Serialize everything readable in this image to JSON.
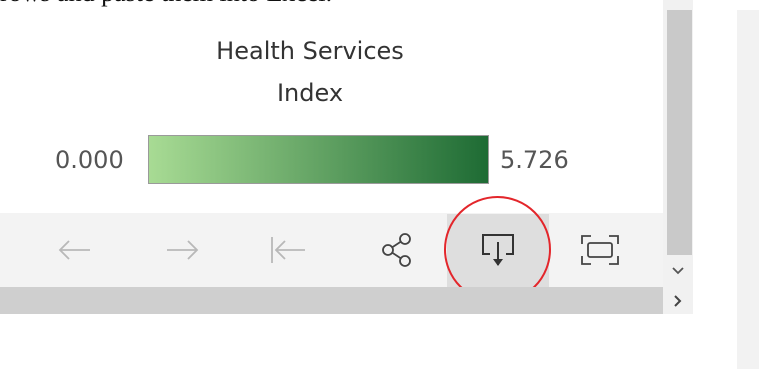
{
  "document": {
    "partial_text": "rows and paste them into Excel."
  },
  "legend": {
    "title_line1": "Health Services",
    "title_line2": "Index",
    "min": "0.000",
    "max": "5.726",
    "gradient_start": "#a8db94",
    "gradient_end": "#1e6b34"
  },
  "toolbar": {
    "buttons": [
      {
        "icon": "undo-arrow-icon",
        "enabled": false
      },
      {
        "icon": "redo-arrow-icon",
        "enabled": false
      },
      {
        "icon": "revert-icon",
        "enabled": false
      },
      {
        "icon": "share-icon",
        "enabled": true
      },
      {
        "icon": "download-icon",
        "enabled": true,
        "highlighted": true
      },
      {
        "icon": "fullscreen-icon",
        "enabled": true
      }
    ]
  },
  "colors": {
    "highlight": "#e3262b",
    "toolbar_bg": "#f3f3f3",
    "disabled_icon": "#b8b8b8",
    "enabled_icon": "#444444"
  }
}
